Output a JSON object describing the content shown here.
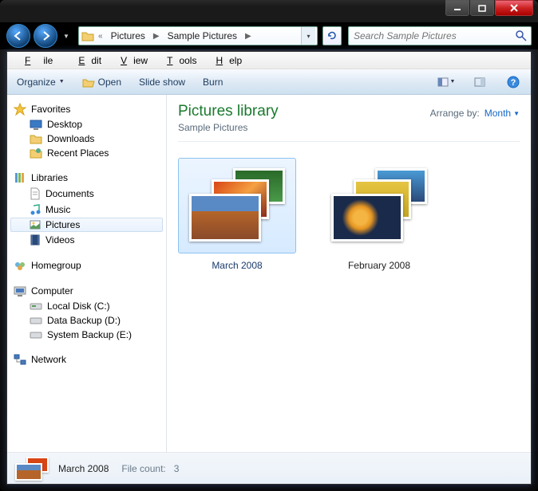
{
  "search": {
    "placeholder": "Search Sample Pictures"
  },
  "breadcrumbs": {
    "b1": "Pictures",
    "b2": "Sample Pictures"
  },
  "menu": {
    "file": "File",
    "edit": "Edit",
    "view": "View",
    "tools": "Tools",
    "help": "Help"
  },
  "toolbar": {
    "organize": "Organize",
    "open": "Open",
    "slideshow": "Slide show",
    "burn": "Burn"
  },
  "side": {
    "favorites": "Favorites",
    "desktop": "Desktop",
    "downloads": "Downloads",
    "recent": "Recent Places",
    "libraries": "Libraries",
    "documents": "Documents",
    "music": "Music",
    "pictures": "Pictures",
    "videos": "Videos",
    "homegroup": "Homegroup",
    "computer": "Computer",
    "drive_c": "Local Disk (C:)",
    "drive_d": "Data Backup (D:)",
    "drive_e": "System Backup (E:)",
    "network": "Network"
  },
  "library": {
    "title": "Pictures library",
    "subtitle": "Sample Pictures",
    "arrange_label": "Arrange by:",
    "arrange_value": "Month"
  },
  "items": {
    "march": "March 2008",
    "february": "February 2008"
  },
  "status": {
    "name": "March 2008",
    "count_label": "File count:",
    "count_value": "3"
  }
}
